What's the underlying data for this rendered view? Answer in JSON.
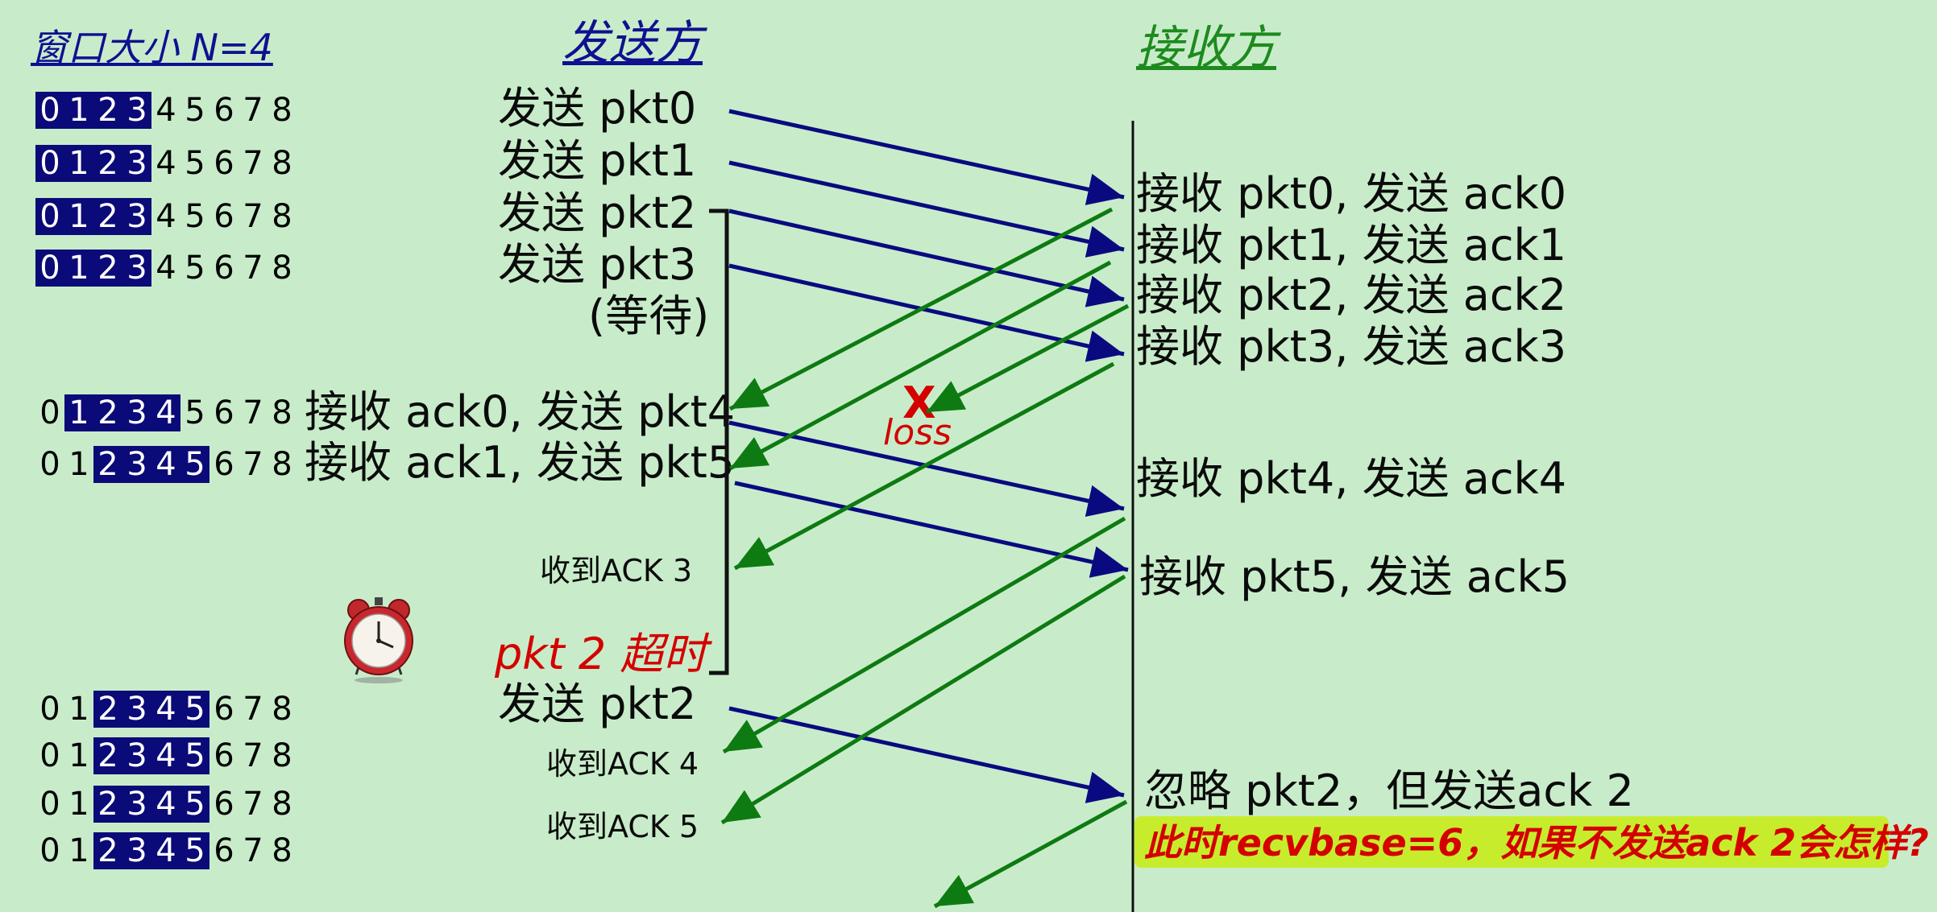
{
  "headers": {
    "window_size": "窗口大小 N=4",
    "sender": "发送方",
    "receiver": "接收方"
  },
  "window_rows": [
    {
      "digits": [
        "0",
        "1",
        "2",
        "3",
        "4",
        "5",
        "6",
        "7",
        "8"
      ],
      "base": 0,
      "window": 4
    },
    {
      "digits": [
        "0",
        "1",
        "2",
        "3",
        "4",
        "5",
        "6",
        "7",
        "8"
      ],
      "base": 0,
      "window": 4
    },
    {
      "digits": [
        "0",
        "1",
        "2",
        "3",
        "4",
        "5",
        "6",
        "7",
        "8"
      ],
      "base": 0,
      "window": 4
    },
    {
      "digits": [
        "0",
        "1",
        "2",
        "3",
        "4",
        "5",
        "6",
        "7",
        "8"
      ],
      "base": 0,
      "window": 4
    },
    {
      "digits": [
        "0",
        "1",
        "2",
        "3",
        "4",
        "5",
        "6",
        "7",
        "8"
      ],
      "base": 1,
      "window": 4
    },
    {
      "digits": [
        "0",
        "1",
        "2",
        "3",
        "4",
        "5",
        "6",
        "7",
        "8"
      ],
      "base": 2,
      "window": 4
    },
    {
      "digits": [
        "0",
        "1",
        "2",
        "3",
        "4",
        "5",
        "6",
        "7",
        "8"
      ],
      "base": 2,
      "window": 4
    },
    {
      "digits": [
        "0",
        "1",
        "2",
        "3",
        "4",
        "5",
        "6",
        "7",
        "8"
      ],
      "base": 2,
      "window": 4
    },
    {
      "digits": [
        "0",
        "1",
        "2",
        "3",
        "4",
        "5",
        "6",
        "7",
        "8"
      ],
      "base": 2,
      "window": 4
    },
    {
      "digits": [
        "0",
        "1",
        "2",
        "3",
        "4",
        "5",
        "6",
        "7",
        "8"
      ],
      "base": 2,
      "window": 4
    }
  ],
  "sender_events": {
    "send_pkt0": "发送  pkt0",
    "send_pkt1": "发送  pkt1",
    "send_pkt2": "发送  pkt2",
    "send_pkt3": "发送  pkt3",
    "wait": "(等待)",
    "recv_ack0_send_pkt4": "接收 ack0, 发送 pkt4",
    "recv_ack1_send_pkt5": "接收 ack1, 发送 pkt5",
    "got_ack3": "收到ACK 3",
    "timeout": "pkt 2 超时",
    "resend_pkt2": "发送  pkt2",
    "got_ack4": "收到ACK 4",
    "got_ack5": "收到ACK 5"
  },
  "receiver_events": {
    "r0": "接收 pkt0, 发送 ack0",
    "r1": "接收 pkt1, 发送 ack1",
    "r2": "接收 pkt2, 发送 ack2",
    "r3": "接收 pkt3, 发送 ack3",
    "r4": "接收 pkt4, 发送 ack4",
    "r5": "接收 pkt5, 发送 ack5",
    "ignore": "忽略 pkt2，但发送ack 2",
    "question": "此时recvbase=6，如果不发送ack 2会怎样?"
  },
  "loss": {
    "mark": "X",
    "label": "loss"
  },
  "colors": {
    "background": "#c8ecca",
    "data_arrow": "#0a0a80",
    "ack_arrow": "#0e7a12",
    "window_fill": "#0a0a78",
    "header_blue": "#101090",
    "header_green": "#1d8a1d",
    "alert_red": "#d40000",
    "highlight": "#c7ec2c"
  },
  "icons": {
    "timer": "alarm-clock-icon"
  }
}
